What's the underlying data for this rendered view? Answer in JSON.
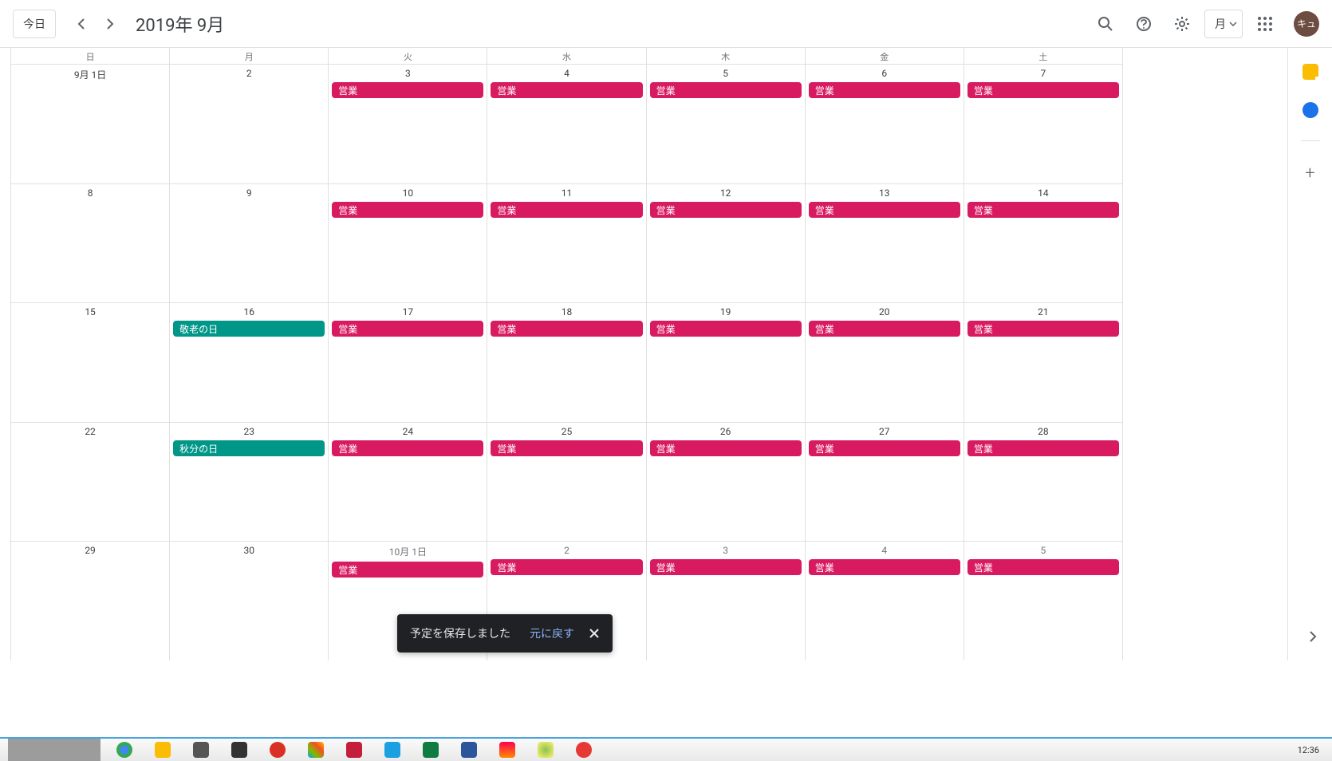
{
  "header": {
    "today_label": "今日",
    "month_title": "2019年 9月",
    "view_label": "月",
    "avatar_label": "キュ"
  },
  "dow": [
    "日",
    "月",
    "火",
    "水",
    "木",
    "金",
    "土"
  ],
  "weeks": [
    [
      {
        "label": "9月 1日",
        "events": []
      },
      {
        "label": "2",
        "events": []
      },
      {
        "label": "3",
        "events": [
          {
            "t": "営業",
            "c": "b"
          }
        ]
      },
      {
        "label": "4",
        "events": [
          {
            "t": "営業",
            "c": "b"
          }
        ]
      },
      {
        "label": "5",
        "events": [
          {
            "t": "営業",
            "c": "b"
          }
        ]
      },
      {
        "label": "6",
        "events": [
          {
            "t": "営業",
            "c": "b"
          }
        ]
      },
      {
        "label": "7",
        "events": [
          {
            "t": "営業",
            "c": "b"
          }
        ]
      }
    ],
    [
      {
        "label": "8",
        "events": []
      },
      {
        "label": "9",
        "events": []
      },
      {
        "label": "10",
        "events": [
          {
            "t": "営業",
            "c": "b"
          }
        ]
      },
      {
        "label": "11",
        "events": [
          {
            "t": "営業",
            "c": "b"
          }
        ]
      },
      {
        "label": "12",
        "events": [
          {
            "t": "営業",
            "c": "b"
          }
        ]
      },
      {
        "label": "13",
        "events": [
          {
            "t": "営業",
            "c": "b"
          }
        ]
      },
      {
        "label": "14",
        "events": [
          {
            "t": "営業",
            "c": "b"
          }
        ]
      }
    ],
    [
      {
        "label": "15",
        "events": []
      },
      {
        "label": "16",
        "events": [
          {
            "t": "敬老の日",
            "c": "h"
          }
        ]
      },
      {
        "label": "17",
        "events": [
          {
            "t": "営業",
            "c": "b"
          }
        ]
      },
      {
        "label": "18",
        "events": [
          {
            "t": "営業",
            "c": "b"
          }
        ]
      },
      {
        "label": "19",
        "events": [
          {
            "t": "営業",
            "c": "b"
          }
        ]
      },
      {
        "label": "20",
        "events": [
          {
            "t": "営業",
            "c": "b"
          }
        ]
      },
      {
        "label": "21",
        "events": [
          {
            "t": "営業",
            "c": "b"
          }
        ]
      }
    ],
    [
      {
        "label": "22",
        "events": []
      },
      {
        "label": "23",
        "events": [
          {
            "t": "秋分の日",
            "c": "h"
          }
        ]
      },
      {
        "label": "24",
        "events": [
          {
            "t": "営業",
            "c": "b"
          }
        ]
      },
      {
        "label": "25",
        "events": [
          {
            "t": "営業",
            "c": "b"
          }
        ]
      },
      {
        "label": "26",
        "events": [
          {
            "t": "営業",
            "c": "b"
          }
        ]
      },
      {
        "label": "27",
        "events": [
          {
            "t": "営業",
            "c": "b"
          }
        ]
      },
      {
        "label": "28",
        "events": [
          {
            "t": "営業",
            "c": "b"
          }
        ]
      }
    ],
    [
      {
        "label": "29",
        "events": []
      },
      {
        "label": "30",
        "events": []
      },
      {
        "label": "10月 1日",
        "other": true,
        "events": [
          {
            "t": "営業",
            "c": "b"
          }
        ]
      },
      {
        "label": "2",
        "other": true,
        "events": [
          {
            "t": "営業",
            "c": "b"
          }
        ]
      },
      {
        "label": "3",
        "other": true,
        "events": [
          {
            "t": "営業",
            "c": "b"
          }
        ]
      },
      {
        "label": "4",
        "other": true,
        "events": [
          {
            "t": "営業",
            "c": "b"
          }
        ]
      },
      {
        "label": "5",
        "other": true,
        "events": [
          {
            "t": "営業",
            "c": "b"
          }
        ]
      }
    ]
  ],
  "toast": {
    "message": "予定を保存しました",
    "undo_label": "元に戻す"
  },
  "clock": "12:36"
}
